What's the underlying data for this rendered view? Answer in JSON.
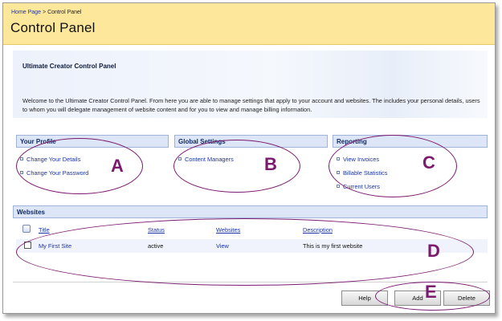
{
  "breadcrumb": {
    "home": "Home Page",
    "separator": ">",
    "current": "Control Panel"
  },
  "page": {
    "title": "Control Panel"
  },
  "intro": {
    "title": "Ultimate Creator Control Panel",
    "text": "Welcome to the Ultimate Creator Control Panel. From here you are able to manage settings that apply to your account and websites. The includes your personal details, users to whom you will delegate management of website content and for you to view and manage billing information."
  },
  "sections": {
    "profile": {
      "title": "Your Profile",
      "links": [
        "Change Your Details",
        "Change Your Password"
      ]
    },
    "global": {
      "title": "Global Settings",
      "links": [
        "Content Managers"
      ]
    },
    "reporting": {
      "title": "Reporting",
      "links": [
        "View Invoices",
        "Billable Statistics",
        "Current Users"
      ]
    }
  },
  "websites": {
    "title": "Websites",
    "columns": [
      "Title",
      "Status",
      "Websites",
      "Description"
    ],
    "rows": [
      {
        "title": "My First Site",
        "status": "active",
        "websites": "View",
        "description": "This is my first website"
      }
    ]
  },
  "buttons": {
    "help": "Help",
    "add": "Add",
    "delete": "Delete"
  },
  "annotations": {
    "a": "A",
    "b": "B",
    "c": "C",
    "d": "D",
    "e": "E"
  },
  "colors": {
    "annotation": "#7b1a70",
    "header_bg": "#fde79a",
    "link": "#1b34a6",
    "section_head": "#dde6f6"
  }
}
